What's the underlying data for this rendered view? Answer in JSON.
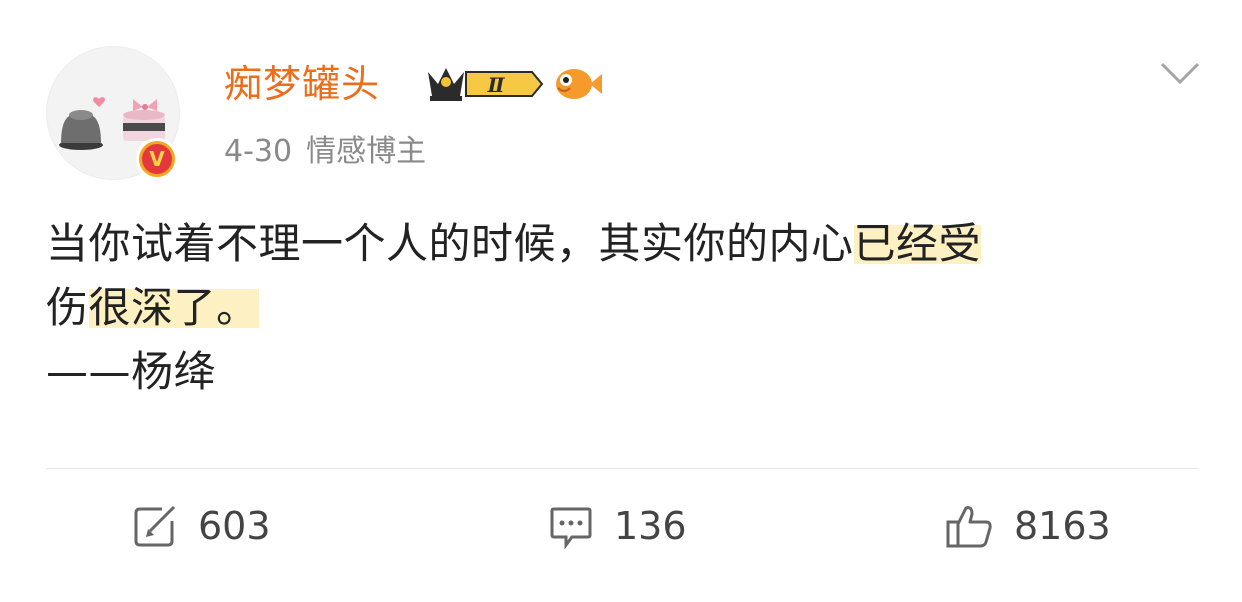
{
  "post": {
    "author": {
      "name": "痴梦罐头",
      "verified_badge": "V",
      "level_badge": "Ⅱ",
      "icons": [
        "avatar-image",
        "crown-level-icon",
        "fish-emoji-icon",
        "verified-v-icon"
      ]
    },
    "meta": {
      "date": "4-30",
      "tag": "情感博主"
    },
    "content": {
      "line_a": "当你试着不理一个人的时候，其实你的内心",
      "line_a_hl": "已经受",
      "line_b_pre": "伤",
      "line_b_hl": "很深了。",
      "line_c": "——杨绛"
    },
    "actions": {
      "repost_count": "603",
      "comment_count": "136",
      "like_count": "8163"
    }
  },
  "colors": {
    "username": "#ec6d1a",
    "meta": "#8a8a8a",
    "highlight": "#fdf0c2",
    "text": "#222222"
  }
}
